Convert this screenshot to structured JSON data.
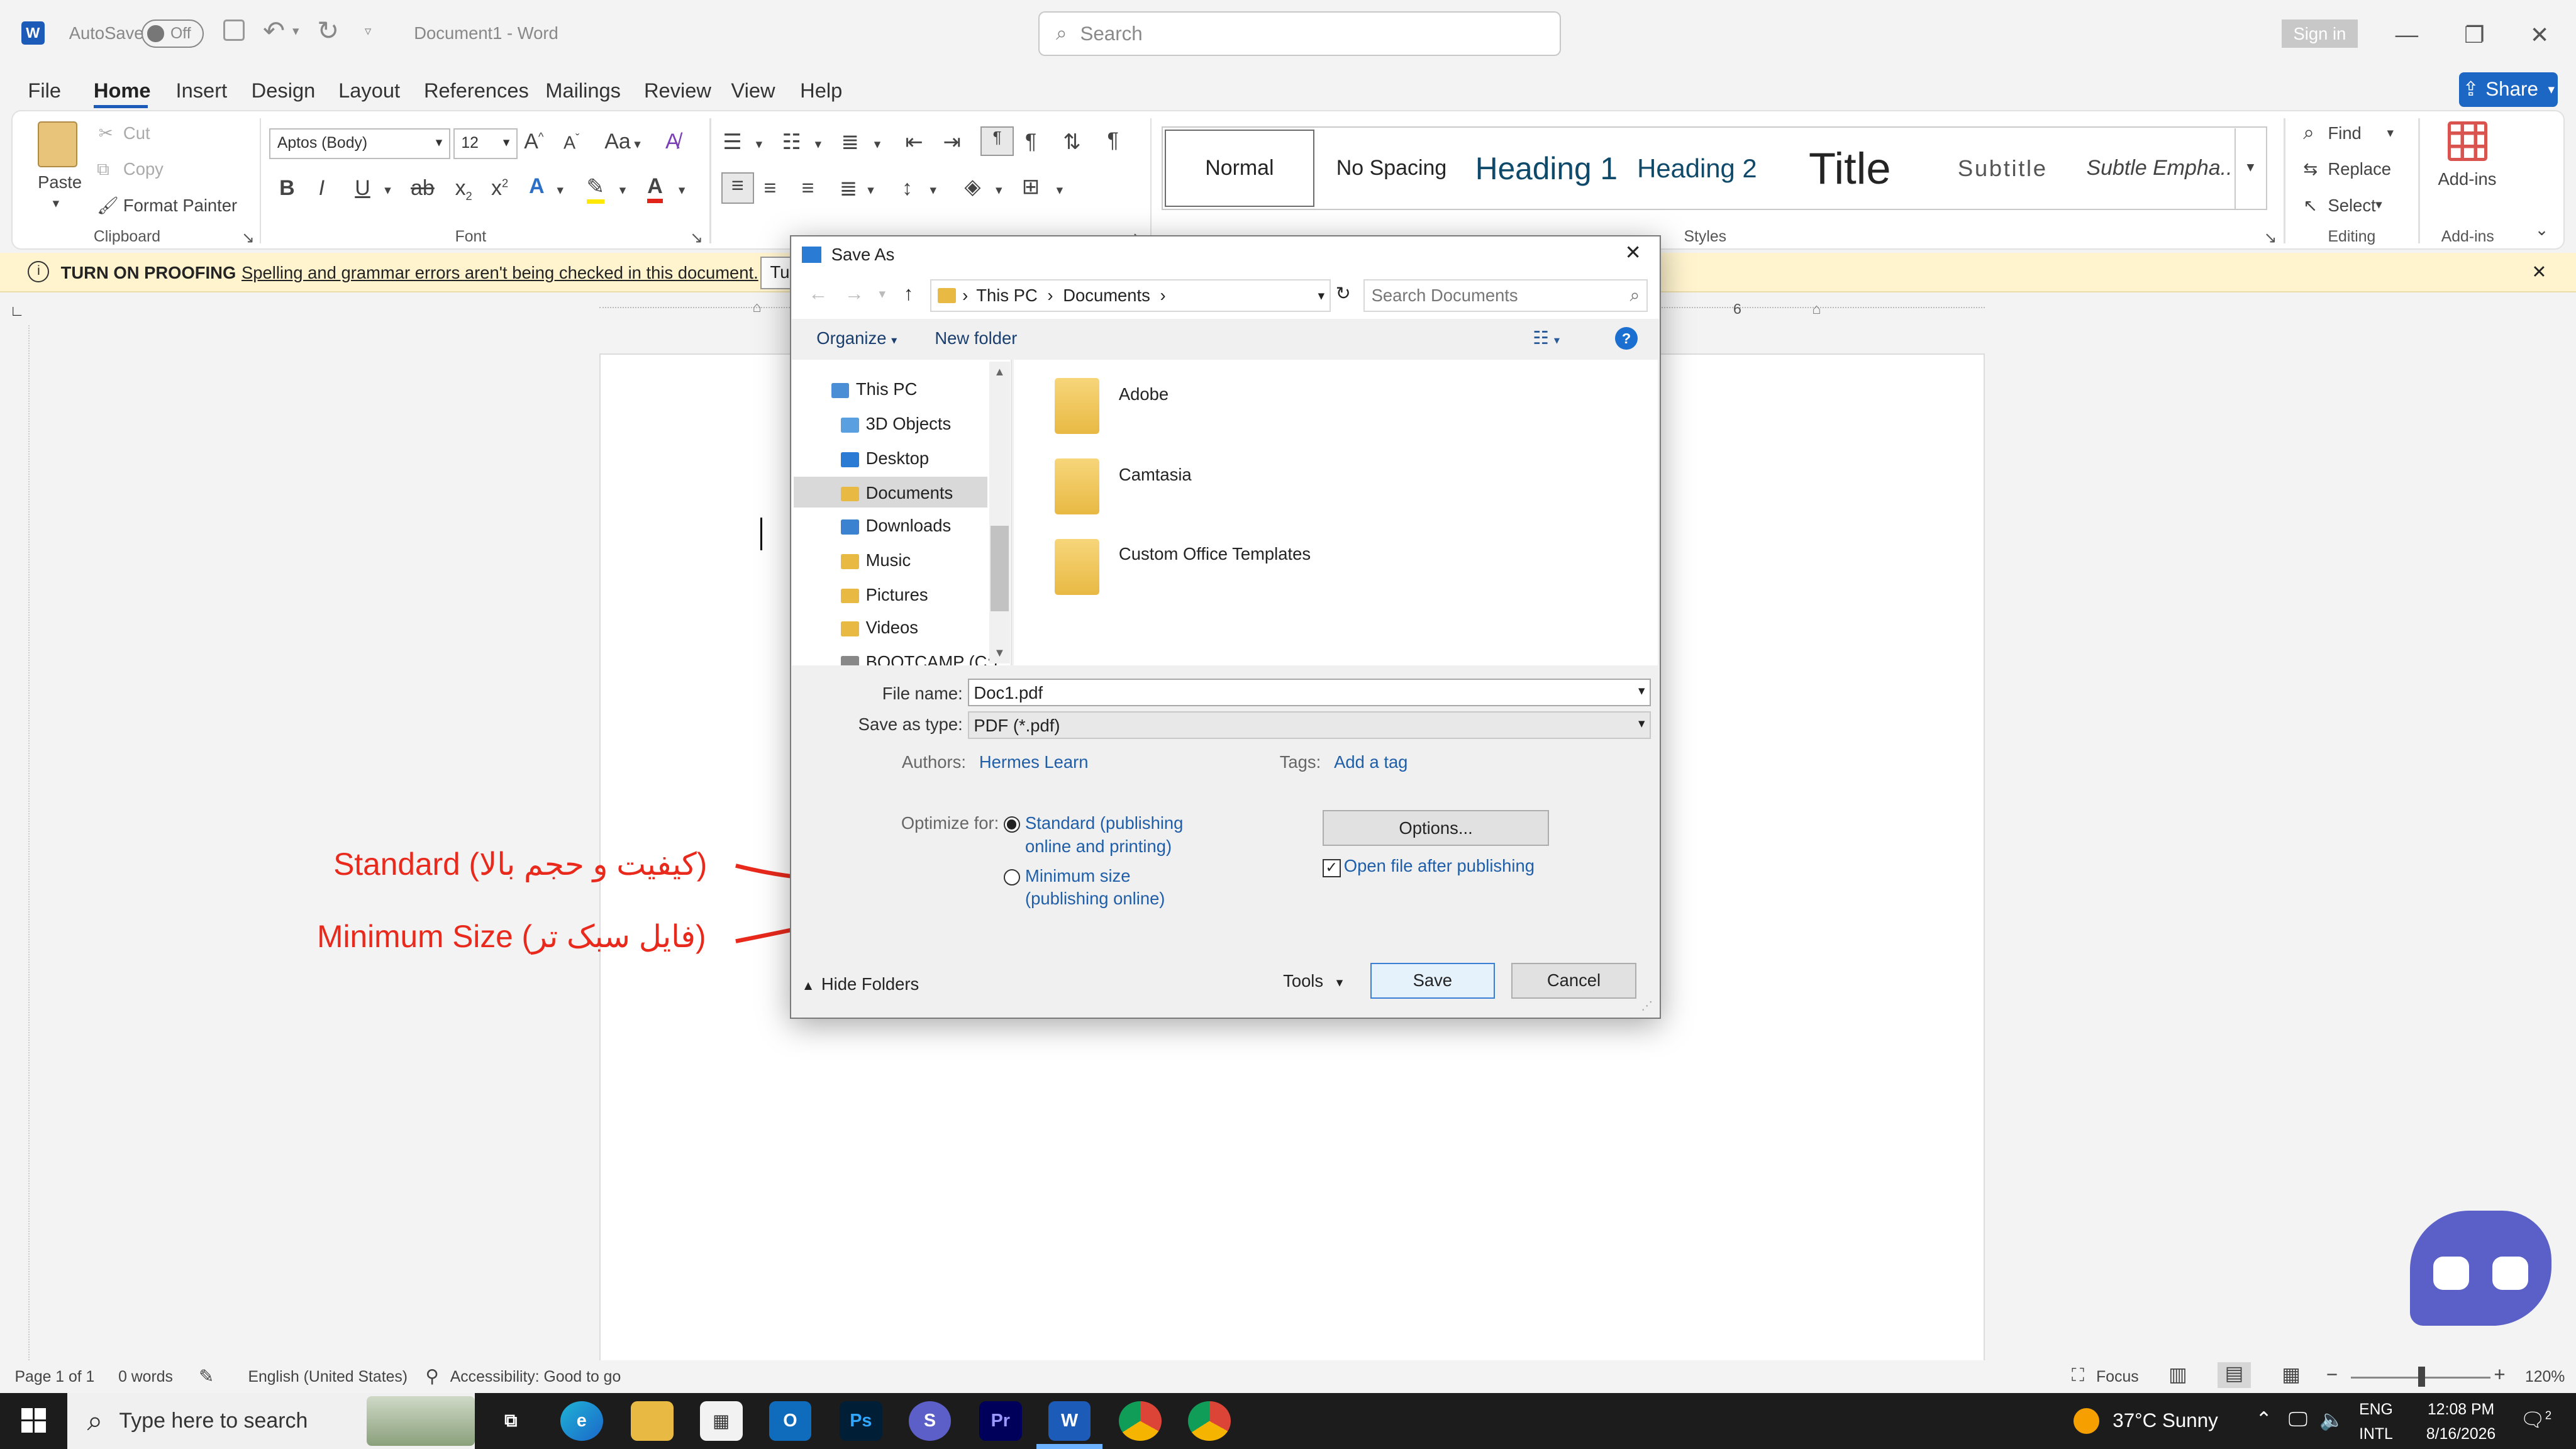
{
  "app": {
    "autosave_label": "AutoSave",
    "autosave_state": "Off",
    "doc_title": "Document1  -  Word",
    "search_placeholder": "Search",
    "sign_in": "Sign in"
  },
  "menu": {
    "tabs": [
      "File",
      "Home",
      "Insert",
      "Design",
      "Layout",
      "References",
      "Mailings",
      "Review",
      "View",
      "Help"
    ],
    "share": "Share"
  },
  "ribbon": {
    "clipboard": {
      "paste": "Paste",
      "cut": "Cut",
      "copy": "Copy",
      "format_painter": "Format Painter",
      "label": "Clipboard"
    },
    "font": {
      "name": "Aptos (Body)",
      "size": "12",
      "label": "Font",
      "aa": "Aa"
    },
    "paragraph": {
      "label": "Paragraph"
    },
    "styles": {
      "items": [
        "Normal",
        "No Spacing",
        "Heading 1",
        "Heading 2",
        "Title",
        "Subtitle",
        "Subtle Empha..."
      ],
      "label": "Styles"
    },
    "editing": {
      "find": "Find",
      "replace": "Replace",
      "select": "Select",
      "label": "Editing"
    },
    "addins": {
      "button": "Add-ins",
      "label": "Add-ins"
    }
  },
  "proofing": {
    "title": "TURN ON PROOFING",
    "message": "Spelling and grammar errors aren't being checked in this document.",
    "button": "Tu"
  },
  "ruler": {
    "mark": "6"
  },
  "dialog": {
    "title": "Save As",
    "breadcrumb": [
      "This PC",
      "Documents"
    ],
    "search_placeholder": "Search Documents",
    "organize": "Organize",
    "new_folder": "New folder",
    "tree": [
      "This PC",
      "3D Objects",
      "Desktop",
      "Documents",
      "Downloads",
      "Music",
      "Pictures",
      "Videos",
      "BOOTCAMP (C:)"
    ],
    "files": [
      "Adobe",
      "Camtasia",
      "Custom Office Templates"
    ],
    "file_name_label": "File name:",
    "file_name": "Doc1.pdf",
    "save_type_label": "Save as type:",
    "save_type": "PDF (*.pdf)",
    "authors_label": "Authors:",
    "authors": "Hermes Learn",
    "tags_label": "Tags:",
    "tags": "Add a tag",
    "optimize_label": "Optimize for:",
    "opt_standard_1": "Standard (publishing",
    "opt_standard_2": "online and printing)",
    "opt_min_1": "Minimum size",
    "opt_min_2": "(publishing online)",
    "options_btn": "Options...",
    "open_after": "Open file after publishing",
    "hide_folders": "Hide Folders",
    "tools": "Tools",
    "save": "Save",
    "cancel": "Cancel"
  },
  "annotations": {
    "standard": "Standard  (کیفیت و حجم بالا)",
    "minimum": "Minimum Size  (فایل سبک تر)"
  },
  "status": {
    "page": "Page 1 of 1",
    "words": "0 words",
    "language": "English (United States)",
    "accessibility": "Accessibility: Good to go",
    "focus": "Focus",
    "zoom": "120%"
  },
  "taskbar": {
    "search": "Type here to search",
    "weather": "37°C  Sunny",
    "lang1": "ENG",
    "lang2": "INTL",
    "time": "12:08 PM",
    "date": "8/16/2026",
    "notif": "2"
  }
}
